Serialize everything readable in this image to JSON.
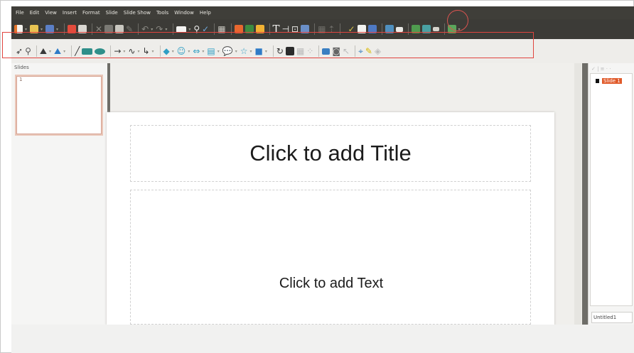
{
  "menubar": {
    "items": [
      "File",
      "Edit",
      "View",
      "Insert",
      "Format",
      "Slide",
      "Slide Show",
      "Tools",
      "Window",
      "Help"
    ]
  },
  "toolbar_standard": {
    "icons": [
      "new-icon",
      "open-icon",
      "save-icon",
      "export-pdf-icon",
      "print-icon",
      "cut-icon",
      "copy-icon",
      "paste-icon",
      "clone-format-icon",
      "undo-icon",
      "redo-icon",
      "display-grid-icon",
      "find-replace-icon",
      "spellcheck-icon",
      "table-icon",
      "image-icon",
      "gallery-icon",
      "chart-icon",
      "text-icon",
      "fontwork-icon",
      "movie-icon",
      "hyperlink-icon",
      "navigator-icon",
      "edit-points-icon",
      "slide-layout-icon",
      "slide-design-icon",
      "presentation-icon",
      "start-show-icon",
      "master-slide-icon",
      "slide-sorter-icon"
    ],
    "highlighted": "edit-points-icon"
  },
  "toolbar_drawing": {
    "icons": [
      "select-icon",
      "zoom-icon",
      "fill-color-icon",
      "line-color-icon",
      "line-icon",
      "rectangle-icon",
      "ellipse-icon",
      "arrow-icon",
      "curve-icon",
      "connector-icon",
      "basic-shapes-icon",
      "symbol-shapes-icon",
      "block-arrows-icon",
      "flowchart-icon",
      "callouts-icon",
      "stars-icon",
      "3d-objects-icon",
      "rotate-icon",
      "align-icon",
      "arrange-icon",
      "distribute-icon",
      "shadow-icon",
      "crop-icon",
      "filter-icon",
      "points-icon",
      "glue-points-icon",
      "toggle-extrusion-icon"
    ]
  },
  "slides_pane": {
    "label": "Slides",
    "thumbnails": [
      {
        "number": "1"
      }
    ]
  },
  "slide": {
    "title_placeholder": "Click to add Title",
    "text_placeholder": "Click to add Text"
  },
  "navigator": {
    "toolbar": "✓ | ≡ · ·",
    "item_label": "Slide 1",
    "document": "Untitled1"
  },
  "colors": {
    "menubar_bg": "#3f3e39",
    "annotation_red": "#e0443e",
    "selection_orange": "#e05a2a"
  }
}
